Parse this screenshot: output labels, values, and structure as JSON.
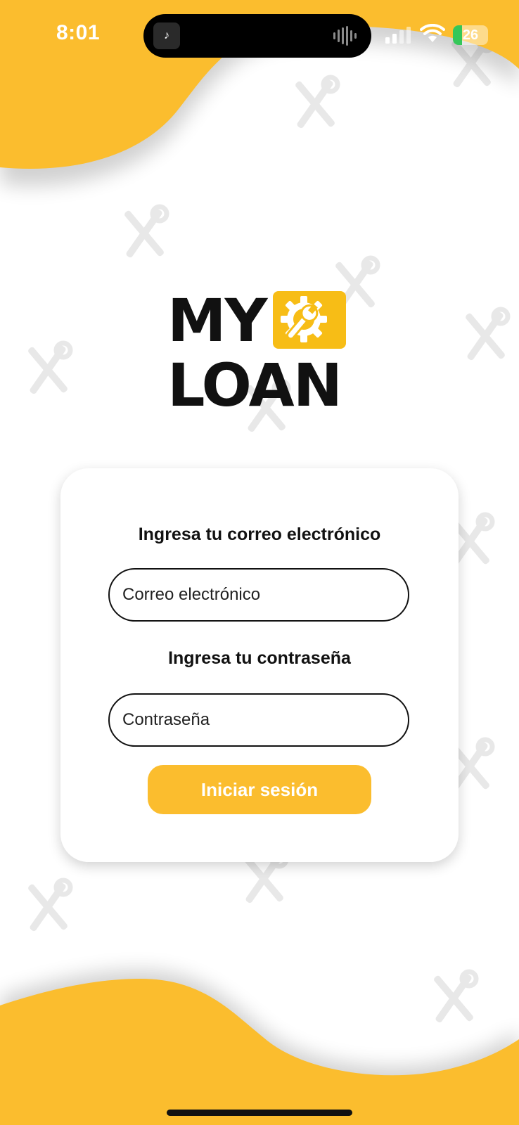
{
  "status_bar": {
    "time": "8:01",
    "battery_level": "26",
    "battery_fraction": 0.26,
    "island_app_glyph": "♪",
    "icons": [
      "music-note-icon",
      "audio-wave-icon",
      "cellular-signal-icon",
      "wifi-icon",
      "battery-charging-icon"
    ]
  },
  "logo": {
    "line1": "MY",
    "line2": "LOAN",
    "badge_icon": "gear-wrench-icon"
  },
  "login_form": {
    "email_label": "Ingresa tu correo electrónico",
    "email_placeholder": "Correo electrónico",
    "password_label": "Ingresa tu contraseña",
    "password_placeholder": "Contraseña",
    "submit_label": "Iniciar sesión"
  },
  "background_pattern_icon": "wrench-screwdriver-icon",
  "colors": {
    "accent": "#fbbd2e",
    "text": "#111111",
    "card": "#ffffff",
    "pattern": "#e9e9e9"
  }
}
